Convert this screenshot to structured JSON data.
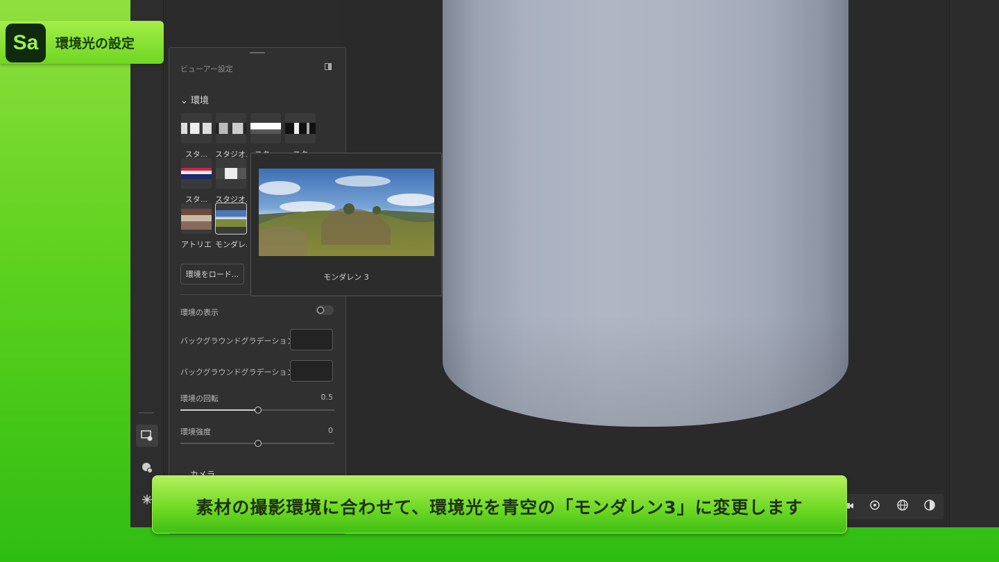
{
  "badge": {
    "logo": "Sa",
    "title": "環境光の設定"
  },
  "panel": {
    "title": "ビューアー設定",
    "section_env": "環境",
    "thumbnails": [
      {
        "label": "スタ..."
      },
      {
        "label": "スタジオ..."
      },
      {
        "label": "スタ..."
      },
      {
        "label": "スタ"
      },
      {
        "label": "スタ..."
      },
      {
        "label": "スタジオ..."
      },
      {
        "label": "アトリエ"
      },
      {
        "label": "モンダレ..."
      }
    ],
    "load_button": "環境をロード...",
    "show_env_label": "環境の表示",
    "show_env_on": false,
    "bg_top_label": "バックグラウンドグラデーション上部",
    "bg_bottom_label": "バックグラウンドグラデーション下部",
    "rotation_label": "環境の回転",
    "rotation_value": "0.5",
    "rotation_fraction": 0.5,
    "intensity_label": "環境強度",
    "intensity_value": "0",
    "intensity_fraction": 0.5,
    "section_camera": "カメラ"
  },
  "preview": {
    "caption": "モンダレン 3"
  },
  "rail_icons": [
    "viewer-settings-icon",
    "material-icon",
    "scene-icon"
  ],
  "viewport_toolbar_icons": [
    "camera-icon",
    "light-icon",
    "globe-icon",
    "sphere-icon"
  ],
  "subtitle": "素材の撮影環境に合わせて、環境光を青空の「モンダレン3」に変更します",
  "colors": {
    "accent_green": "#6fd623",
    "panel_bg": "#303030",
    "viewport_bg": "#2a2a2a"
  }
}
